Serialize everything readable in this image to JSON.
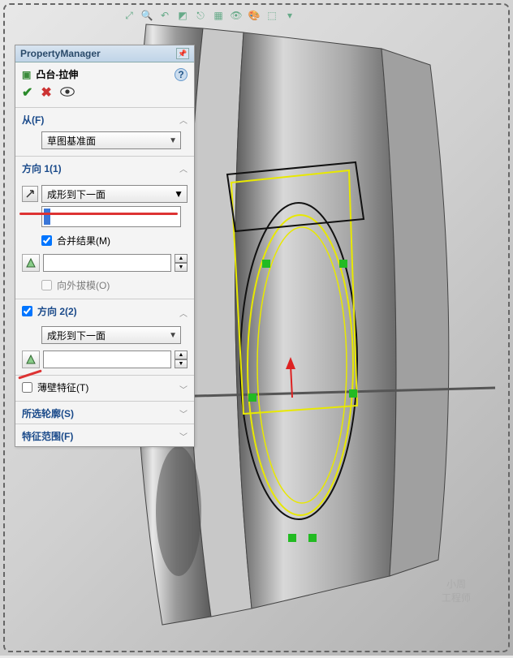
{
  "pm_title": "PropertyManager",
  "feature": {
    "title": "凸台-拉伸"
  },
  "from": {
    "label": "从(F)",
    "value": "草图基准面"
  },
  "dir1": {
    "label": "方向 1(1)",
    "end_condition": "成形到下一面",
    "merge": {
      "checked": true,
      "label": "合并结果(M)"
    },
    "draft_outward": {
      "checked": false,
      "label": "向外拔模(O)"
    }
  },
  "dir2": {
    "enabled": true,
    "label": "方向 2(2)",
    "end_condition": "成形到下一面"
  },
  "thin": {
    "enabled": false,
    "label": "薄壁特征(T)"
  },
  "contours": {
    "label": "所选轮廓(S)"
  },
  "scope": {
    "label": "特征范围(F)"
  },
  "watermark": {
    "line1": "小周",
    "line2": "工程师"
  }
}
